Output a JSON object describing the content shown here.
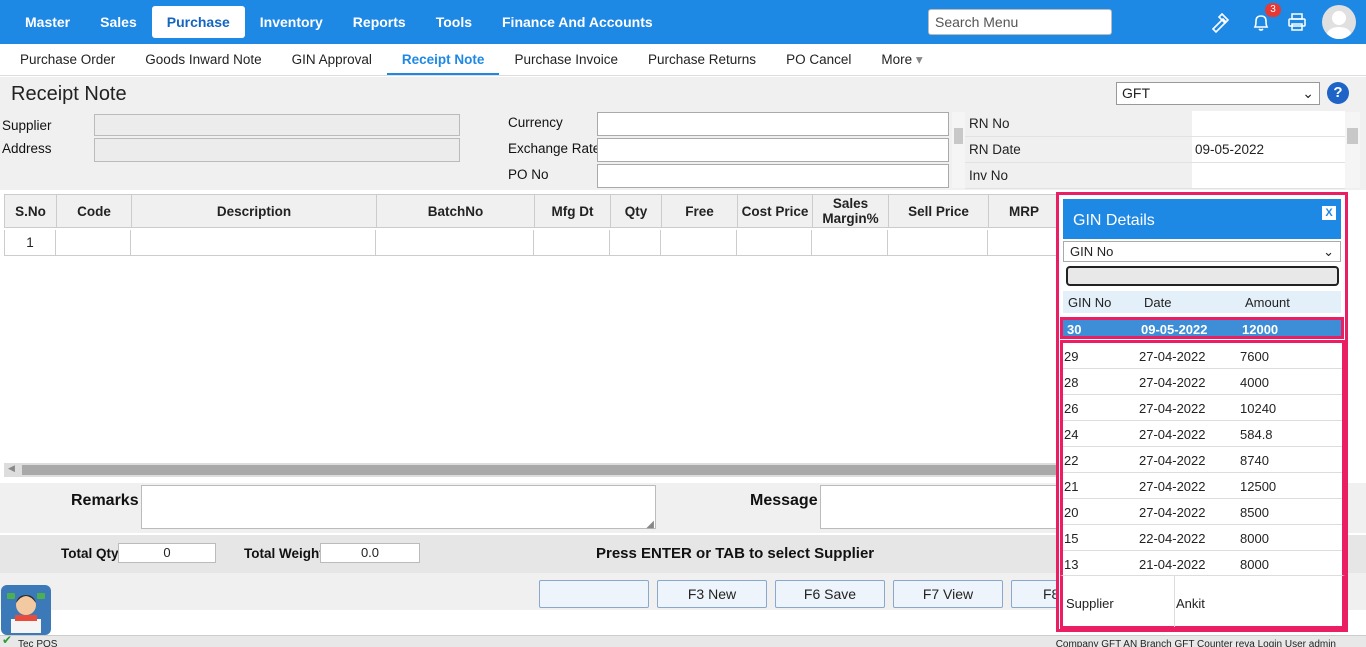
{
  "topnav": [
    "Master",
    "Sales",
    "Purchase",
    "Inventory",
    "Reports",
    "Tools",
    "Finance And Accounts"
  ],
  "search": {
    "placeholder": "Search Menu"
  },
  "notifications": {
    "count": "3"
  },
  "subnav": [
    "Purchase Order",
    "Goods Inward Note",
    "GIN Approval",
    "Receipt Note",
    "Purchase Invoice",
    "Purchase Returns",
    "PO Cancel",
    "More"
  ],
  "page": {
    "title": "Receipt Note",
    "branch_select": "GFT"
  },
  "form": {
    "supplier_label": "Supplier",
    "address_label": "Address",
    "currency_label": "Currency",
    "exchange_rate_label": "Exchange Rate",
    "po_no_label": "PO No",
    "rn_no_label": "RN No",
    "rn_no_value": "",
    "rn_date_label": "RN Date",
    "rn_date_value": "09-05-2022",
    "inv_no_label": "Inv No",
    "inv_no_value": ""
  },
  "grid": {
    "columns": [
      "S.No",
      "Code",
      "Description",
      "BatchNo",
      "Mfg Dt",
      "Qty",
      "Free",
      "Cost Price",
      "Sales Margin%",
      "Sell Price",
      "MRP"
    ],
    "first_row_sno": "1"
  },
  "bottom": {
    "remarks_label": "Remarks",
    "message_label": "Message",
    "total_qty_label": "Total Qty",
    "total_qty_value": "0",
    "total_weight_label": "Total Weight",
    "total_weight_value": "0.0",
    "hint": "Press ENTER or TAB to select Supplier"
  },
  "buttons": {
    "blank": "",
    "new": "F3 New",
    "save": "F6 Save",
    "view": "F7 View",
    "f8": "F8"
  },
  "status": {
    "left": "Tec POS",
    "right": "Company GFT AN  Branch GFT  Counter reva  Login User admin"
  },
  "gin": {
    "title": "GIN Details",
    "close": "X",
    "filter": "GIN No",
    "headers": [
      "GIN No",
      "Date",
      "Amount"
    ],
    "selected": {
      "no": "30",
      "date": "09-05-2022",
      "amount": "12000"
    },
    "rows": [
      {
        "no": "29",
        "date": "27-04-2022",
        "amount": "7600"
      },
      {
        "no": "28",
        "date": "27-04-2022",
        "amount": "4000"
      },
      {
        "no": "26",
        "date": "27-04-2022",
        "amount": "10240"
      },
      {
        "no": "24",
        "date": "27-04-2022",
        "amount": "584.8"
      },
      {
        "no": "22",
        "date": "27-04-2022",
        "amount": "8740"
      },
      {
        "no": "21",
        "date": "27-04-2022",
        "amount": "12500"
      },
      {
        "no": "20",
        "date": "27-04-2022",
        "amount": "8500"
      },
      {
        "no": "15",
        "date": "22-04-2022",
        "amount": "8000"
      },
      {
        "no": "13",
        "date": "21-04-2022",
        "amount": "8000"
      }
    ],
    "supplier_label": "Supplier",
    "supplier_value": "Ankit"
  }
}
